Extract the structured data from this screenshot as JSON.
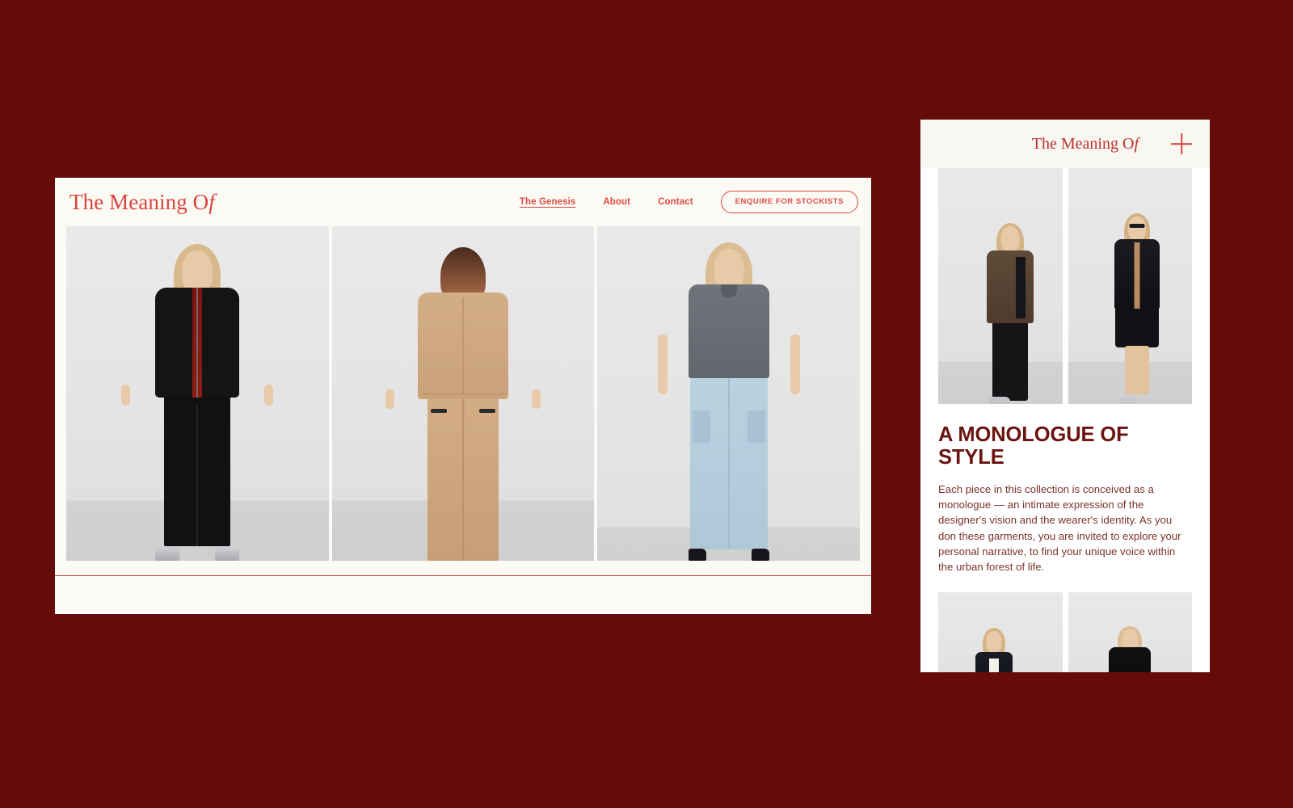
{
  "page": {
    "background_color": "#650B0A",
    "brand_red": "#D9453F",
    "deep_maroon": "#6B1410",
    "cream": "#FBFAF5"
  },
  "desktop": {
    "logo": "The Meaning Of",
    "logo_main": "The Meaning O",
    "logo_italic": "f",
    "nav": [
      {
        "label": "The Genesis",
        "active": true
      },
      {
        "label": "About",
        "active": false
      },
      {
        "label": "Contact",
        "active": false
      }
    ],
    "cta_label": "ENQUIRE FOR STOCKISTS",
    "gallery": [
      {
        "name": "look-one-black-zip-jacket",
        "alt": "Front view, model in black zip jacket with red shirt, black trousers and silver sneakers"
      },
      {
        "name": "look-two-tan-utility-set",
        "alt": "Back view, model in tan utility jacket and cargo trousers"
      },
      {
        "name": "look-three-grey-polo-denim",
        "alt": "Front view, model in grey polo shirt with light blue denim cargo trousers"
      }
    ]
  },
  "mobile": {
    "logo_main": "The Meaning O",
    "logo_italic": "f",
    "menu_icon": "plus-icon",
    "heading": "A MONOLOGUE OF STYLE",
    "paragraph": "Each piece in this collection is conceived as a monologue — an intimate expression of the designer's vision and the wearer's identity. As you don these garments, you are invited to explore your personal narrative, to find your unique voice within the urban forest of life.",
    "tiles_top": [
      {
        "name": "mobile-look-brown-jacket",
        "alt": "Side profile, model in brown jacket with black crop top and black wide trousers"
      },
      {
        "name": "mobile-look-black-suit",
        "alt": "Side profile, model in black jacket and skirt wearing sunglasses"
      }
    ],
    "tiles_bottom": [
      {
        "name": "mobile-look-navy-blazer",
        "alt": "Model in navy blazer over white top"
      },
      {
        "name": "mobile-look-black-turtleneck",
        "alt": "Model in black high-neck jacket"
      }
    ]
  }
}
